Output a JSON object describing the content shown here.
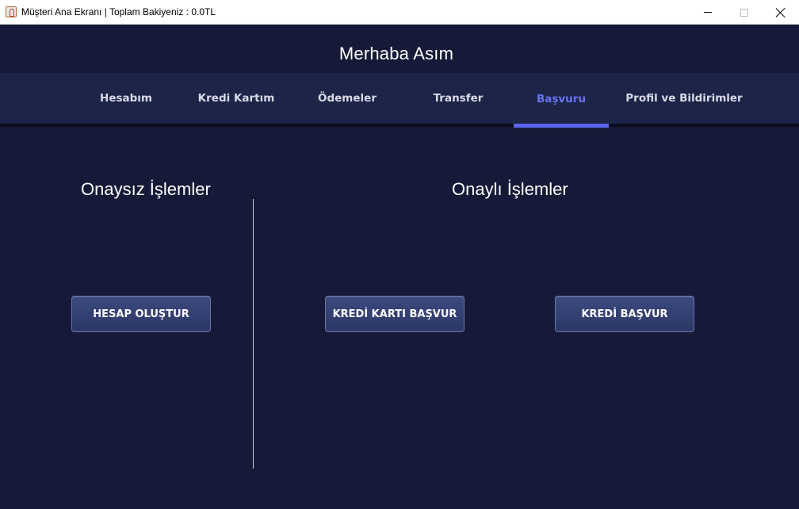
{
  "window": {
    "title": "Müşteri Ana Ekranı | Toplam Bakiyeniz : 0.0TL",
    "icon": "java-cup-icon"
  },
  "header": {
    "greeting": "Merhaba Asım"
  },
  "tabs": [
    {
      "label": "Hesabım",
      "active": false
    },
    {
      "label": "Kredi Kartım",
      "active": false
    },
    {
      "label": "Ödemeler",
      "active": false
    },
    {
      "label": "Transfer",
      "active": false
    },
    {
      "label": "Başvuru",
      "active": true
    },
    {
      "label": "Profil ve Bildirimler",
      "active": false
    }
  ],
  "sections": {
    "unapproved": {
      "title": "Onaysız İşlemler",
      "buttons": [
        "HESAP OLUŞTUR"
      ]
    },
    "approved": {
      "title": "Onaylı İşlemler",
      "buttons": [
        "KREDİ KARTI BAŞVUR",
        "KREDİ BAŞVUR"
      ]
    }
  },
  "colors": {
    "background": "#161a38",
    "tabbar": "#1c2448",
    "accent": "#5b64ee",
    "button": "#33406f"
  }
}
